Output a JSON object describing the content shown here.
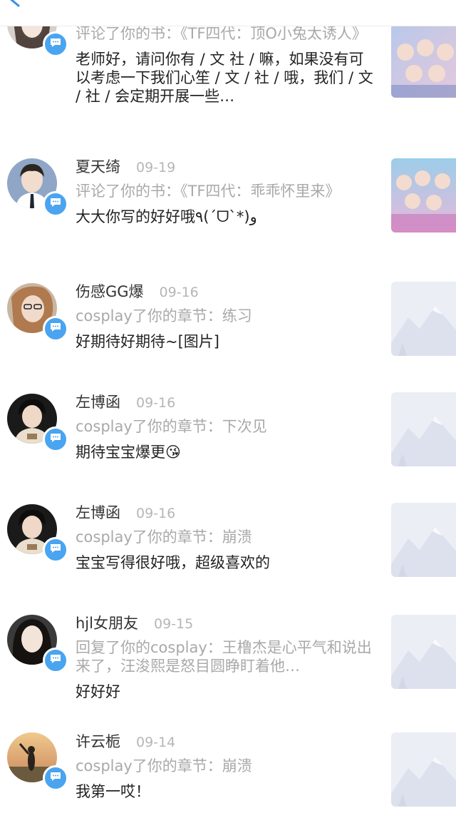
{
  "messages": [
    {
      "name": "",
      "date": "",
      "action": "评论了你的书：《TF四代：顶O小兔太诱人》",
      "comment": "老师好，请问你有 / 文 社 / 嘛，如果没有可以考虑一下我们心笙 / 文 / 社 / 哦，我们 / 文 / 社 / 会定期开展一些…",
      "thumbnail": "book-cover"
    },
    {
      "name": "夏天绮",
      "date": "09-19",
      "action": "评论了你的书：《TF四代：乖乖怀里来》",
      "comment": "大大你写的好好哦٩(ˊᗜˋ*)و",
      "thumbnail": "book-cover"
    },
    {
      "name": "伤感GG爆",
      "date": "09-16",
      "action": "cosplay了你的章节：练习",
      "comment": "好期待好期待~[图片]",
      "thumbnail": "placeholder-image"
    },
    {
      "name": "左博函",
      "date": "09-16",
      "action": "cosplay了你的章节：下次见",
      "comment": "期待宝宝爆更😘",
      "thumbnail": "placeholder-image"
    },
    {
      "name": "左博函",
      "date": "09-16",
      "action": "cosplay了你的章节：崩溃",
      "comment": "宝宝写得很好哦，超级喜欢的",
      "thumbnail": "placeholder-image"
    },
    {
      "name": "hjl女朋友",
      "date": "09-15",
      "action": "回复了你的cosplay：王橹杰是心平气和说出来了，汪浚熙是怒目圆睁盯着他…",
      "comment": "好好好",
      "thumbnail": "placeholder-image"
    },
    {
      "name": "许云栀",
      "date": "09-14",
      "action": "cosplay了你的章节：崩溃",
      "comment": "我第一哎！",
      "thumbnail": "placeholder-image"
    }
  ],
  "icons": {
    "back": "back-arrow-icon",
    "badge": "comment-bubble-icon"
  },
  "colors": {
    "accent": "#4aa4ef",
    "name": "#333333",
    "meta": "#a9a9a9",
    "comment": "#222222"
  }
}
